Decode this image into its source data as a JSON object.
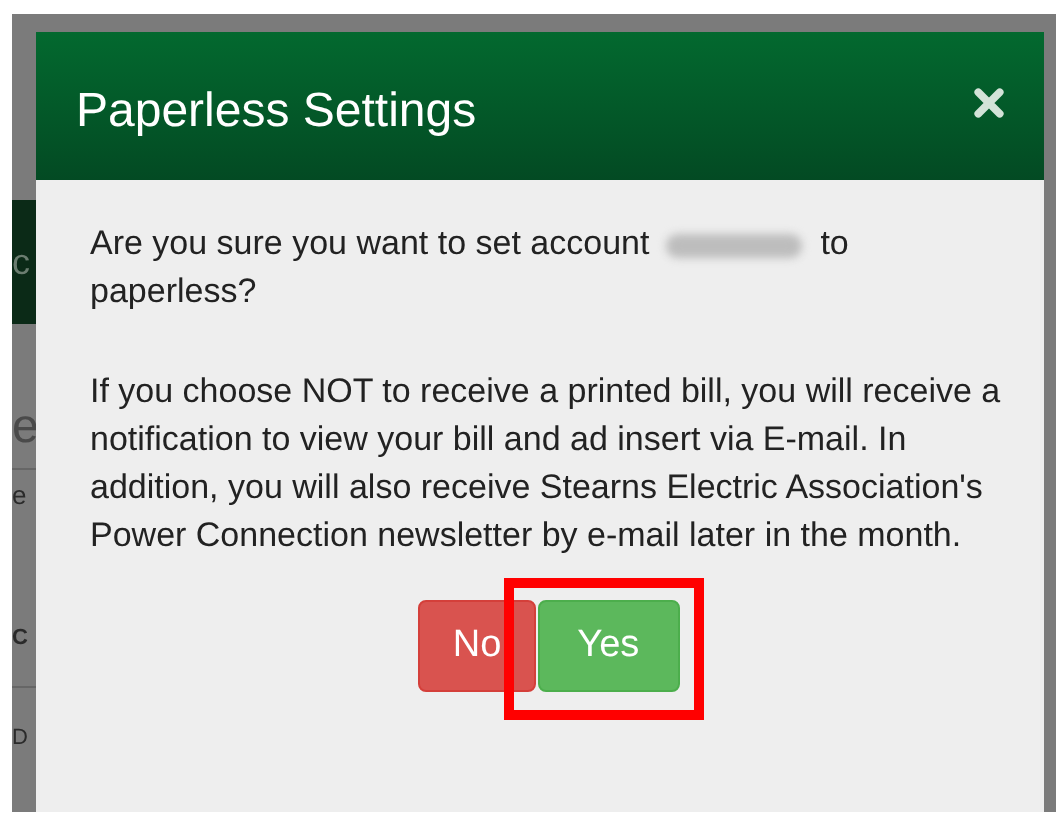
{
  "background": {
    "texts": [
      "c",
      "e",
      "e",
      "C",
      "D"
    ]
  },
  "dialog": {
    "title": "Paperless Settings",
    "question_before": "Are you sure you want to set account",
    "question_after": "to",
    "question_end": "paperless?",
    "details": "If you choose NOT to receive a printed bill, you will receive a notification to view your bill and ad insert via E-mail. In addition, you will also receive Stearns Electric Association's Power Connection newsletter by e-mail later in the month.",
    "buttons": [
      {
        "label": "No",
        "kind": "danger",
        "highlighted": false
      },
      {
        "label": "Yes",
        "kind": "success",
        "highlighted": true
      }
    ]
  }
}
